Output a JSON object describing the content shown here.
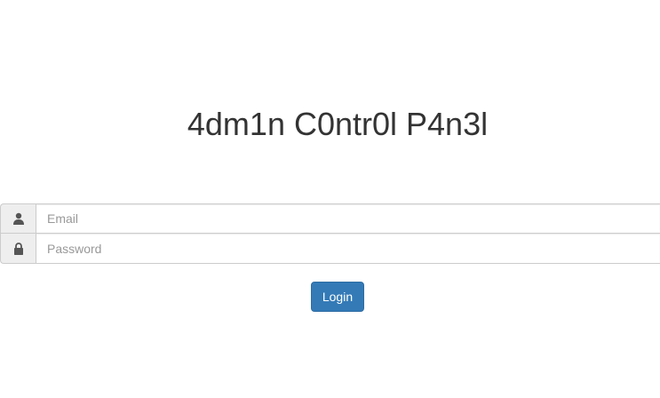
{
  "header": {
    "title": "4dm1n C0ntr0l P4n3l"
  },
  "login_form": {
    "email": {
      "icon": "user-icon",
      "placeholder": "Email",
      "value": ""
    },
    "password": {
      "icon": "lock-icon",
      "placeholder": "Password",
      "value": ""
    },
    "submit_label": "Login"
  },
  "colors": {
    "button_primary": "#337ab7",
    "addon_background": "#eeeeee",
    "title_text": "#333333"
  }
}
